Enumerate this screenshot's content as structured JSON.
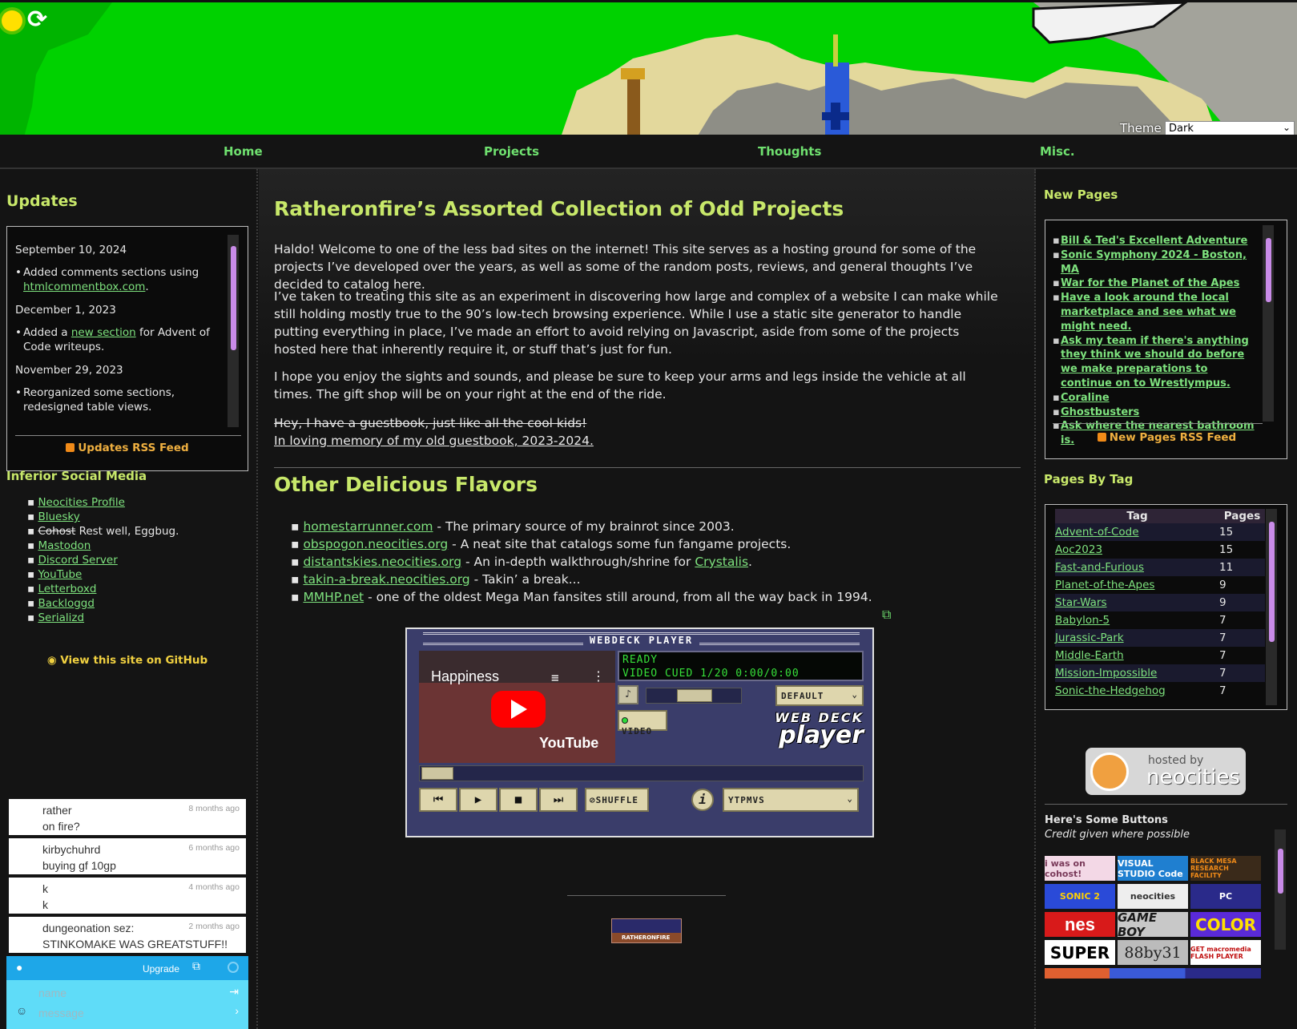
{
  "theme": {
    "label": "Theme",
    "selected": "Dark"
  },
  "nav": {
    "home": "Home",
    "projects": "Projects",
    "thoughts": "Thoughts",
    "misc": "Misc."
  },
  "updates": {
    "title": "Updates",
    "entries": [
      {
        "date": "September 10, 2024",
        "pre": "Added comments sections using ",
        "link": "htmlcommentbox.com",
        "post": "."
      },
      {
        "date": "December 1, 2023",
        "pre": "Added a ",
        "link": "new section",
        "post": " for Advent of Code writeups."
      },
      {
        "date": "November 29, 2023",
        "pre": "Reorganized some sections, redesigned table views.",
        "link": "",
        "post": ""
      }
    ],
    "rss": "Updates RSS Feed"
  },
  "social": {
    "title": "Inferior Social Media",
    "items": [
      "Neocities Profile",
      "Bluesky",
      "Mastodon",
      "Discord Server",
      "YouTube",
      "Letterboxd",
      "Backloggd",
      "Serializd"
    ],
    "cohost_strike": "Cohost",
    "cohost_rest": " Rest well, Eggbug.",
    "github": "View this site on GitHub"
  },
  "chat": {
    "messages": [
      {
        "name": "rather",
        "msg": "on fire?",
        "time": "8 months ago"
      },
      {
        "name": "kirbychuhrd",
        "msg": "buying gf 10gp",
        "time": "6 months ago"
      },
      {
        "name": "k",
        "msg": "k",
        "time": "4 months ago"
      },
      {
        "name": "dungeonation sez:",
        "msg": "STINKOMAKE WAS GREATSTUFF!!",
        "time": "2 months ago"
      }
    ],
    "upgrade": "Upgrade",
    "name_placeholder": "name",
    "message_placeholder": "message"
  },
  "main": {
    "title": "Ratheronfire’s Assorted Collection of Odd Projects",
    "p1": "Haldo! Welcome to one of the less bad sites on the internet! This site serves as a hosting ground for some of the projects I’ve developed over the years, as well as some of the random posts, reviews, and general thoughts I’ve decided to catalog here.",
    "p2": "I’ve taken to treating this site as an experiment in discovering how large and complex of a website I can make while still holding mostly true to the 90’s low-tech browsing experience. While I use a static site generator to handle putting everything in place, I’ve made an effort to avoid relying on Javascript, aside from some of the projects hosted here that inherently require it, or stuff that’s just for fun.",
    "p3": "I hope you enjoy the sights and sounds, and please be sure to keep your arms and legs inside the vehicle at all times. The gift shop will be on your right at the end of the ride.",
    "guestbook_strike": "Hey, I have a guestbook, just like all the cool kids!",
    "guestbook_link": "In loving memory of my old guestbook, 2023-2024.",
    "flavors_title": "Other Delicious Flavors",
    "flavors": [
      {
        "link": "homestarrunner.com",
        "text": " - The primary source of my brainrot since 2003.",
        "link2": "",
        "tail": ""
      },
      {
        "link": "obspogon.neocities.org",
        "text": " - A neat site that catalogs some fun fangame projects.",
        "link2": "",
        "tail": ""
      },
      {
        "link": "distantskies.neocities.org",
        "text": " - An in-depth walkthrough/shrine for ",
        "link2": "Crystalis",
        "tail": "."
      },
      {
        "link": "takin-a-break.neocities.org",
        "text": " - Takin’ a break...",
        "link2": "",
        "tail": ""
      },
      {
        "link": "MMHP.net",
        "text": " - one of the oldest Mega Man fansites still around, from all the way back in 1994.",
        "link2": "",
        "tail": ""
      }
    ]
  },
  "player": {
    "title": "WEBDECK PLAYER",
    "video_title": "Happiness",
    "youtube": "YouTube",
    "status1": "READY",
    "status2": "VIDEO CUED 1/20 0:00/0:00",
    "preset": "DEFAULT",
    "video_toggle": "VIDEO",
    "logo1": "WEB DECK",
    "logo2": "player",
    "shuffle": "SHUFFLE",
    "playlist": "YTPMVS",
    "badge": "RATHERONFIRE"
  },
  "new_pages": {
    "title": "New Pages",
    "items": [
      "Bill & Ted's Excellent Adventure",
      "Sonic Symphony 2024 - Boston, MA",
      "War for the Planet of the Apes",
      "Have a look around the local marketplace and see what we might need.",
      "Ask my team if there's anything they think we should do before we make preparations to continue on to Wrestlympus.",
      "Coraline",
      "Ghostbusters",
      "Ask where the nearest bathroom is."
    ],
    "rss": "New Pages RSS Feed"
  },
  "tags": {
    "title": "Pages By Tag",
    "col_tag": "Tag",
    "col_pages": "Pages",
    "rows": [
      {
        "tag": "Advent-of-Code",
        "pages": "15"
      },
      {
        "tag": "Aoc2023",
        "pages": "15"
      },
      {
        "tag": "Fast-and-Furious",
        "pages": "11"
      },
      {
        "tag": "Planet-of-the-Apes",
        "pages": "9"
      },
      {
        "tag": "Star-Wars",
        "pages": "9"
      },
      {
        "tag": "Babylon-5",
        "pages": "7"
      },
      {
        "tag": "Jurassic-Park",
        "pages": "7"
      },
      {
        "tag": "Middle-Earth",
        "pages": "7"
      },
      {
        "tag": "Mission-Impossible",
        "pages": "7"
      },
      {
        "tag": "Sonic-the-Hedgehog",
        "pages": "7"
      }
    ]
  },
  "hosted": {
    "line1": "hosted by",
    "line2": "neocities"
  },
  "buttons": {
    "title": "Here's Some Buttons",
    "subtitle": "Credit given where possible",
    "items": [
      "i was on cohost!",
      "VISUAL STUDIO Code",
      "BLACK MESA RESEARCH FACILITY",
      "SONIC 2",
      "neocities",
      "PC",
      "nes",
      "GAME BOY",
      "COLOR",
      "SUPER",
      "88by31",
      "GET macromedia FLASH PLAYER"
    ]
  },
  "colors": {
    "accent": "#7ee27e",
    "heading": "#c8e86a",
    "banner": "#00d200"
  }
}
